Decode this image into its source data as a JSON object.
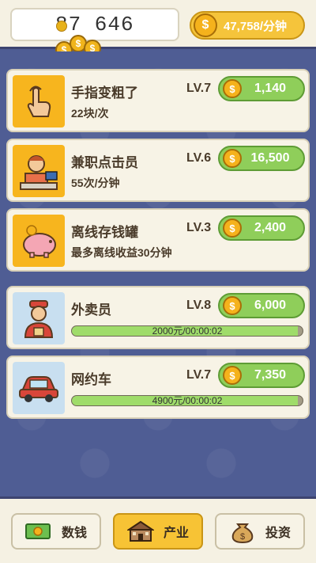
{
  "header": {
    "counter_value": "87 646",
    "rate_text": "47,758/分钟",
    "coin_symbol": "$"
  },
  "cards": [
    {
      "title": "手指变粗了",
      "subtitle": "22块/次",
      "level": "LV.7",
      "price": "1,140",
      "icon": "finger-tap-icon"
    },
    {
      "title": "兼职点击员",
      "subtitle": "55次/分钟",
      "level": "LV.6",
      "price": "16,500",
      "icon": "clerk-icon"
    },
    {
      "title": "离线存钱罐",
      "subtitle": "最多离线收益30分钟",
      "level": "LV.3",
      "price": "2,400",
      "icon": "piggy-bank-icon"
    },
    {
      "title": "外卖员",
      "level": "LV.8",
      "price": "6,000",
      "progress_text": "2000元/00:00:02",
      "progress": 0.98,
      "icon": "delivery-man-icon"
    },
    {
      "title": "网约车",
      "level": "LV.7",
      "price": "7,350",
      "progress_text": "4900元/00:00:02",
      "progress": 0.98,
      "icon": "car-icon"
    }
  ],
  "tabs": [
    {
      "label": "数钱",
      "icon": "cash-icon",
      "active": false
    },
    {
      "label": "产业",
      "icon": "building-icon",
      "active": true
    },
    {
      "label": "投资",
      "icon": "money-bag-icon",
      "active": false
    }
  ],
  "colors": {
    "background": "#4f5d94",
    "card": "#f7f3e6",
    "buy_button": "#8fce5a",
    "coin": "#f5b21c",
    "active_tab": "#f7c335"
  }
}
